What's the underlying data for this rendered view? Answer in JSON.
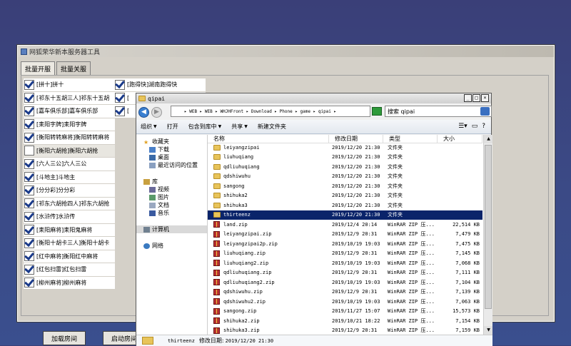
{
  "tool": {
    "title": "网狐荣华新本服务器工具",
    "tabs": [
      "批量开服",
      "批量关服"
    ],
    "games_col1": [
      {
        "label": "[拼十]拼十",
        "checked": true
      },
      {
        "label": "[祁东十五胡三人]祁东十五胡",
        "checked": true
      },
      {
        "label": "[嘉车俱乐部]嘉车俱乐部",
        "checked": true
      },
      {
        "label": "[耒阳字牌]耒阳字牌",
        "checked": true
      },
      {
        "label": "[衡阳转转麻将]衡阳转转麻将",
        "checked": true
      },
      {
        "label": "[衡阳六胡抢]衡阳六胡抢",
        "checked": false
      },
      {
        "label": "[六人三公]六人三公",
        "checked": true
      },
      {
        "label": "[斗地主]斗地主",
        "checked": true
      },
      {
        "label": "[分分彩]分分彩",
        "checked": true
      },
      {
        "label": "[祁东六胡抢四人]祁东六胡抢",
        "checked": true
      },
      {
        "label": "[水浒传]水浒传",
        "checked": true
      },
      {
        "label": "[耒阳麻将]耒阳鬼麻将",
        "checked": true
      },
      {
        "label": "[衡阳十胡卡三人]衡阳十胡卡",
        "checked": true
      },
      {
        "label": "[红中麻将]衡阳红中麻将",
        "checked": true
      },
      {
        "label": "[红包扫雷]红包扫雷",
        "checked": true
      },
      {
        "label": "[柳州麻将]柳州麻将",
        "checked": true
      }
    ],
    "games_col2": [
      {
        "label": "[跑得快]湖南跑得快",
        "checked": true
      },
      {
        "label": "[",
        "checked": true
      },
      {
        "label": "[",
        "checked": true
      }
    ],
    "load_button": "加载房间",
    "start_button": "启动房间"
  },
  "explorer": {
    "title": "qipai",
    "address": "▸ WEB ▸ WEB ▸ WHJHFront ▸ Download ▸ Phone ▸ game ▸ qipai ▸",
    "search_placeholder": "搜索 qipai",
    "toolbar": [
      "组织",
      "打开",
      "包含到库中",
      "共享",
      "新建文件夹"
    ],
    "nav": {
      "favorites": "收藏夹",
      "favorites_items": [
        "下载",
        "桌面",
        "最近访问的位置"
      ],
      "libraries": "库",
      "libraries_items": [
        "视频",
        "图片",
        "文档",
        "音乐"
      ],
      "computer": "计算机",
      "network": "网络"
    },
    "columns": [
      "名称",
      "修改日期",
      "类型",
      "大小"
    ],
    "files": [
      {
        "name": "leiyangzipai",
        "date": "2019/12/20 21:30",
        "type": "文件夹",
        "size": "",
        "kind": "folder"
      },
      {
        "name": "liuhuqiang",
        "date": "2019/12/20 21:30",
        "type": "文件夹",
        "size": "",
        "kind": "folder"
      },
      {
        "name": "qdliuhuqiang",
        "date": "2019/12/20 21:30",
        "type": "文件夹",
        "size": "",
        "kind": "folder"
      },
      {
        "name": "qdshiwuhu",
        "date": "2019/12/20 21:30",
        "type": "文件夹",
        "size": "",
        "kind": "folder"
      },
      {
        "name": "sangong",
        "date": "2019/12/20 21:30",
        "type": "文件夹",
        "size": "",
        "kind": "folder"
      },
      {
        "name": "shihuka2",
        "date": "2019/12/20 21:30",
        "type": "文件夹",
        "size": "",
        "kind": "folder"
      },
      {
        "name": "shihuka3",
        "date": "2019/12/20 21:30",
        "type": "文件夹",
        "size": "",
        "kind": "folder"
      },
      {
        "name": "thirteenz",
        "date": "2019/12/20 21:30",
        "type": "文件夹",
        "size": "",
        "kind": "folder",
        "selected": true
      },
      {
        "name": "land.zip",
        "date": "2019/12/4 20:14",
        "type": "WinRAR ZIP 压...",
        "size": "22,514 KB",
        "kind": "zip"
      },
      {
        "name": "leiyangzipai.zip",
        "date": "2019/12/9 20:31",
        "type": "WinRAR ZIP 压...",
        "size": "7,479 KB",
        "kind": "zip"
      },
      {
        "name": "leiyangzipai2p.zip",
        "date": "2019/10/19 19:03",
        "type": "WinRAR ZIP 压...",
        "size": "7,475 KB",
        "kind": "zip"
      },
      {
        "name": "liuhuqiang.zip",
        "date": "2019/12/9 20:31",
        "type": "WinRAR ZIP 压...",
        "size": "7,145 KB",
        "kind": "zip"
      },
      {
        "name": "liuhuqiang2.zip",
        "date": "2019/10/19 19:03",
        "type": "WinRAR ZIP 压...",
        "size": "7,068 KB",
        "kind": "zip"
      },
      {
        "name": "qdliuhuqiang.zip",
        "date": "2019/12/9 20:31",
        "type": "WinRAR ZIP 压...",
        "size": "7,111 KB",
        "kind": "zip"
      },
      {
        "name": "qdliuhuqiang2.zip",
        "date": "2019/10/19 19:03",
        "type": "WinRAR ZIP 压...",
        "size": "7,104 KB",
        "kind": "zip"
      },
      {
        "name": "qdshiwuhu.zip",
        "date": "2019/12/9 20:31",
        "type": "WinRAR ZIP 压...",
        "size": "7,139 KB",
        "kind": "zip"
      },
      {
        "name": "qdshiwuhu2.zip",
        "date": "2019/10/19 19:03",
        "type": "WinRAR ZIP 压...",
        "size": "7,063 KB",
        "kind": "zip"
      },
      {
        "name": "sangong.zip",
        "date": "2019/11/27 15:07",
        "type": "WinRAR ZIP 压...",
        "size": "15,573 KB",
        "kind": "zip"
      },
      {
        "name": "shihuka2.zip",
        "date": "2019/10/21 18:22",
        "type": "WinRAR ZIP 压...",
        "size": "7,154 KB",
        "kind": "zip"
      },
      {
        "name": "shihuka3.zip",
        "date": "2019/12/9 20:31",
        "type": "WinRAR ZIP 压...",
        "size": "7,159 KB",
        "kind": "zip"
      }
    ],
    "details": {
      "name": "thirteenz",
      "label": "修改日期:",
      "date": "2019/12/20 21:30"
    }
  }
}
